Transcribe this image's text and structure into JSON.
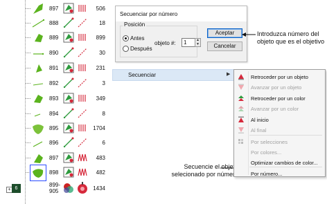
{
  "object_list": {
    "rows": [
      {
        "num": "897",
        "count": "506"
      },
      {
        "num": "888",
        "count": "18"
      },
      {
        "num": "889",
        "count": "899"
      },
      {
        "num": "890",
        "count": "30"
      },
      {
        "num": "891",
        "count": "231"
      },
      {
        "num": "892",
        "count": "3"
      },
      {
        "num": "893",
        "count": "349"
      },
      {
        "num": "894",
        "count": "8"
      },
      {
        "num": "895",
        "count": "1704"
      },
      {
        "num": "896",
        "count": "6"
      },
      {
        "num": "897",
        "count": "483"
      },
      {
        "num": "898",
        "count": "482"
      }
    ],
    "group_row": {
      "num_line1": "899-",
      "num_line2": "905",
      "count": "1434",
      "badge": "6"
    }
  },
  "dialog": {
    "title": "Secuenciar por número",
    "group_label": "Posición",
    "radio_before": "Antes",
    "radio_after": "Después",
    "object_label": "objeto #:",
    "object_value": "1",
    "ok_label": "Aceptar",
    "cancel_label": "Cancelar"
  },
  "callouts": {
    "top": "Introduzca número del objeto que es el objetivo",
    "bottom": "Secuencie el objeto selecionado por número"
  },
  "menu_strip": {
    "label": "Secuenciar"
  },
  "context_menu": {
    "items": [
      {
        "label": "Retroceder por un objeto",
        "enabled": true,
        "icon": "move-back-object-icon"
      },
      {
        "label": "Avanzar por un objeto",
        "enabled": false,
        "icon": "move-forward-object-icon"
      },
      {
        "label": "Retroceder por un color",
        "enabled": true,
        "icon": "move-back-color-icon"
      },
      {
        "label": "Avanzar por un color",
        "enabled": false,
        "icon": "move-forward-color-icon"
      },
      {
        "label": "Al inicio",
        "enabled": true,
        "icon": "to-start-icon"
      },
      {
        "label": "Al final",
        "enabled": false,
        "icon": "to-end-icon"
      },
      {
        "label": "Por selecciones",
        "enabled": false,
        "icon": "by-selection-icon"
      },
      {
        "label": "Por colores...",
        "enabled": false,
        "icon": ""
      },
      {
        "label": "Optimizar cambios de color...",
        "enabled": true,
        "icon": ""
      },
      {
        "label": "Por número...",
        "enabled": true,
        "icon": ""
      }
    ]
  },
  "colors": {
    "accent": "#2a4bff",
    "menu_highlight": "#dbe8f6",
    "thread_red": "#d6293b",
    "leaf_green": "#5bb31e"
  }
}
